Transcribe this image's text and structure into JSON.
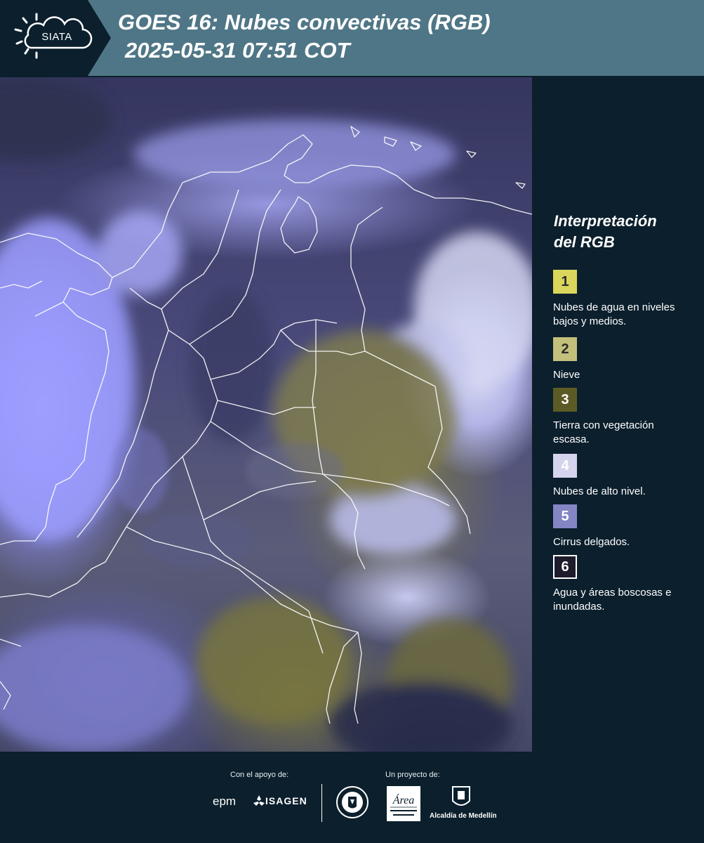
{
  "header": {
    "logo_text": "SIATA",
    "title_line1": "GOES 16: Nubes convectivas (RGB)",
    "title_line2": "2025-05-31 07:51 COT"
  },
  "legend": {
    "title_line1": "Interpretación",
    "title_line2": "del RGB",
    "items": [
      {
        "number": "1",
        "color": "#d9d65b",
        "label": "Nubes de agua en niveles bajos y medios."
      },
      {
        "number": "2",
        "color": "#c2c07a",
        "label": "Nieve"
      },
      {
        "number": "3",
        "color": "#5d5b25",
        "label": "Tierra con vegetación escasa."
      },
      {
        "number": "4",
        "color": "#d5d4ee",
        "label": "Nubes de alto nivel."
      },
      {
        "number": "5",
        "color": "#8485c5",
        "label": "Cirrus delgados."
      },
      {
        "number": "6",
        "color": "#1d1b2c",
        "label": "Agua y áreas boscosas e inundadas."
      }
    ]
  },
  "footer": {
    "support_label": "Con el apoyo de:",
    "project_label": "Un proyecto de:",
    "sponsors": [
      "epm",
      "ISAGEN"
    ],
    "partners": [
      "Área Metropolitana Valle de Aburrá",
      "Alcaldía de Medellín"
    ],
    "alcaldia_name": "Alcaldía de Medellín"
  }
}
